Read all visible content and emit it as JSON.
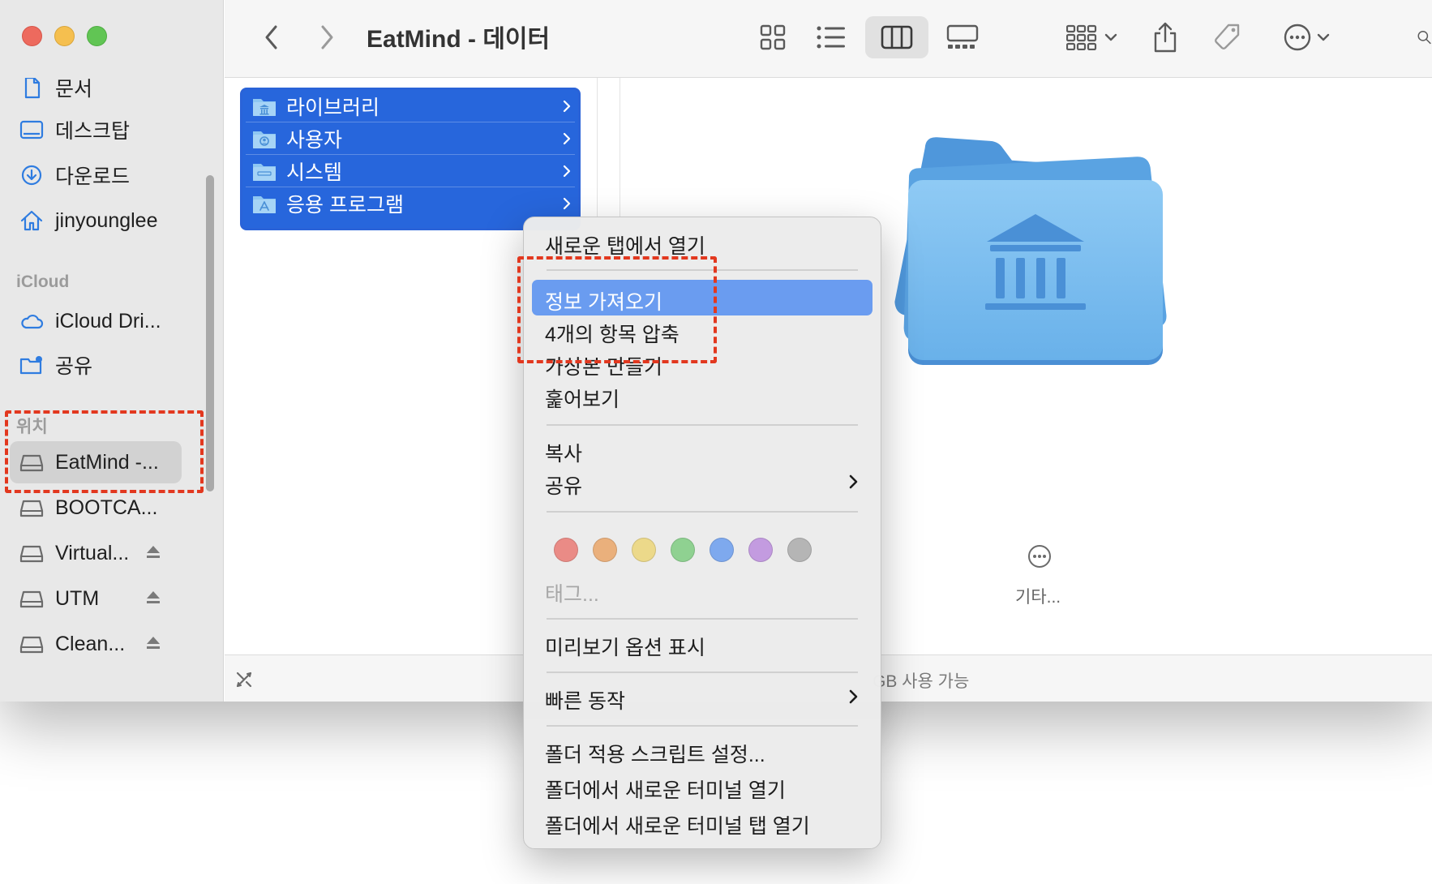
{
  "window": {
    "title": "EatMind - 데이터"
  },
  "sidebar": {
    "favorites": [
      {
        "label": "문서",
        "icon": "document-icon"
      },
      {
        "label": "데스크탑",
        "icon": "desktop-icon"
      },
      {
        "label": "다운로드",
        "icon": "download-icon"
      },
      {
        "label": "jinyounglee",
        "icon": "home-icon"
      }
    ],
    "icloud_header": "iCloud",
    "icloud": [
      {
        "label": "iCloud Dri...",
        "icon": "cloud-icon"
      },
      {
        "label": "공유",
        "icon": "shared-folder-icon"
      }
    ],
    "locations_header": "위치",
    "locations": [
      {
        "label": "EatMind -...",
        "icon": "disk-icon",
        "selected": true,
        "eject": false
      },
      {
        "label": "BOOTCA...",
        "icon": "disk-icon",
        "selected": false,
        "eject": false
      },
      {
        "label": "Virtual...",
        "icon": "disk-icon",
        "selected": false,
        "eject": true
      },
      {
        "label": "UTM",
        "icon": "disk-icon",
        "selected": false,
        "eject": true
      },
      {
        "label": "Clean...",
        "icon": "disk-icon",
        "selected": false,
        "eject": true
      }
    ]
  },
  "toolbar": {
    "back": "chevron-left-icon",
    "forward": "chevron-right-icon",
    "views": [
      "icon-view-icon",
      "list-view-icon",
      "column-view-icon",
      "gallery-view-icon"
    ],
    "active_view": "column-view-icon",
    "group": "group-icon",
    "share": "share-icon",
    "tag": "tag-icon",
    "action": "ellipsis-circle-icon"
  },
  "column": {
    "items": [
      {
        "label": "라이브러리",
        "icon": "library-folder-icon"
      },
      {
        "label": "사용자",
        "icon": "users-folder-icon"
      },
      {
        "label": "시스템",
        "icon": "system-folder-icon"
      },
      {
        "label": "응용 프로그램",
        "icon": "applications-folder-icon"
      }
    ]
  },
  "preview": {
    "more_label": "기타..."
  },
  "statusbar": {
    "text": "GB 사용 가능"
  },
  "context_menu": {
    "items": [
      {
        "label": "새로운 탭에서 열기"
      },
      {
        "label": "정보 가져오기",
        "highlighted": true
      },
      {
        "label": "4개의 항목 압축"
      },
      {
        "label": "가상본 만들기"
      },
      {
        "label": "훑어보기"
      },
      {
        "label": "복사"
      },
      {
        "label": "공유",
        "submenu": true
      },
      {
        "label": "태그...",
        "disabled": true
      },
      {
        "label": "미리보기 옵션 표시"
      },
      {
        "label": "빠른 동작",
        "submenu": true
      },
      {
        "label": "폴더 적용 스크립트 설정..."
      },
      {
        "label": "폴더에서 새로운 터미널 열기"
      },
      {
        "label": "폴더에서 새로운 터미널 탭 열기"
      }
    ],
    "tag_colors": [
      "#ea8b86",
      "#eab07c",
      "#ecd98a",
      "#8fd191",
      "#7ea9ee",
      "#c39be0",
      "#b5b5b5"
    ]
  },
  "colors": {
    "selection": "#2766dc",
    "highlight": "#6a9cf0",
    "annotation": "#e2381f"
  }
}
